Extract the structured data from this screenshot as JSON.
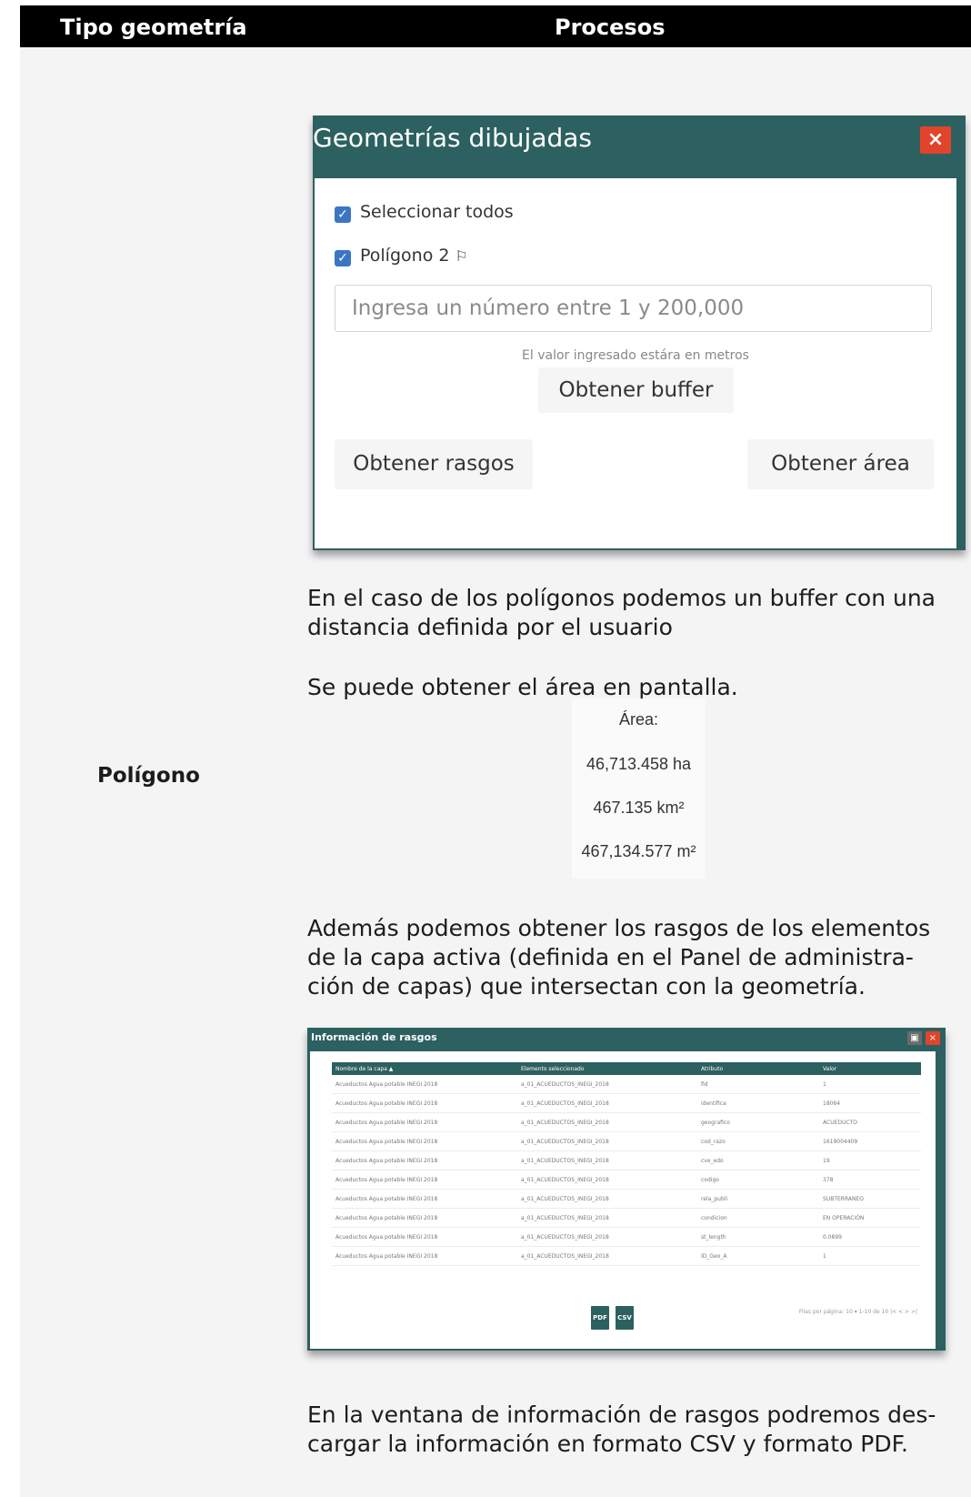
{
  "header": {
    "col1": "Tipo geometría",
    "col2": "Procesos"
  },
  "row": {
    "geometry_type": "Polígono"
  },
  "dialog": {
    "title": "Geometrías dibujadas",
    "close_icon": "×",
    "select_all": "Seleccionar todos",
    "polygon_item": "Polígono 2",
    "buffer_placeholder": "Ingresa un número entre 1 y 200,000",
    "hint": "El valor ingresado estára en metros",
    "buffer_button": "Obtener buffer",
    "features_button": "Obtener rasgos",
    "area_button": "Obtener área"
  },
  "paragraphs": {
    "p1_line1": "En el caso de los polígonos podemos un buffer con una",
    "p1_line2": "distancia definida por el usuario",
    "p2": "Se puede obtener el área en pantalla.",
    "p3_line1": "Además podemos obtener los rasgos de los elementos",
    "p3_line2": "de la capa activa (definida en el Panel de administra-",
    "p3_line3": "ción de capas) que intersectan con la geometría.",
    "p4_line1": "En la ventana de información de rasgos podremos des-",
    "p4_line2": "cargar la información en formato CSV y formato PDF."
  },
  "area": {
    "label": "Área:",
    "ha": "46,713.458 ha",
    "km2": "467.135 km²",
    "m2": "467,134.577 m²"
  },
  "features_window": {
    "title": "Información de rasgos",
    "columns": [
      "Nombre de la capa ▲",
      "Elemento seleccionado",
      "Atributo",
      "Valor"
    ],
    "rows": [
      [
        "Acueductos Agua potable INEGI 2018",
        "a_01_ACUEDUCTOS_INEGI_2018",
        "fid",
        "1"
      ],
      [
        "Acueductos Agua potable INEGI 2018",
        "a_01_ACUEDUCTOS_INEGI_2018",
        "identifica",
        "18064"
      ],
      [
        "Acueductos Agua potable INEGI 2018",
        "a_01_ACUEDUCTOS_INEGI_2018",
        "geografico",
        "ACUEDUCTO"
      ],
      [
        "Acueductos Agua potable INEGI 2018",
        "a_01_ACUEDUCTOS_INEGI_2018",
        "cod_razo",
        "1619004409"
      ],
      [
        "Acueductos Agua potable INEGI 2018",
        "a_01_ACUEDUCTOS_INEGI_2018",
        "cve_edo",
        "19"
      ],
      [
        "Acueductos Agua potable INEGI 2018",
        "a_01_ACUEDUCTOS_INEGI_2018",
        "codigo",
        "378"
      ],
      [
        "Acueductos Agua potable INEGI 2018",
        "a_01_ACUEDUCTOS_INEGI_2018",
        "rela_publi",
        "SUBTERRANEO"
      ],
      [
        "Acueductos Agua potable INEGI 2018",
        "a_01_ACUEDUCTOS_INEGI_2018",
        "condicion",
        "EN OPERACIÓN"
      ],
      [
        "Acueductos Agua potable INEGI 2018",
        "a_01_ACUEDUCTOS_INEGI_2018",
        "st_length",
        "0.0899"
      ],
      [
        "Acueductos Agua potable INEGI 2018",
        "a_01_ACUEDUCTOS_INEGI_2018",
        "ID_Geo_A",
        "1"
      ]
    ],
    "pager": "Filas por página: 10  ▾    1-10 de 10    |<   <   >   >|",
    "pdf_label": "PDF",
    "csv_label": "CSV"
  }
}
